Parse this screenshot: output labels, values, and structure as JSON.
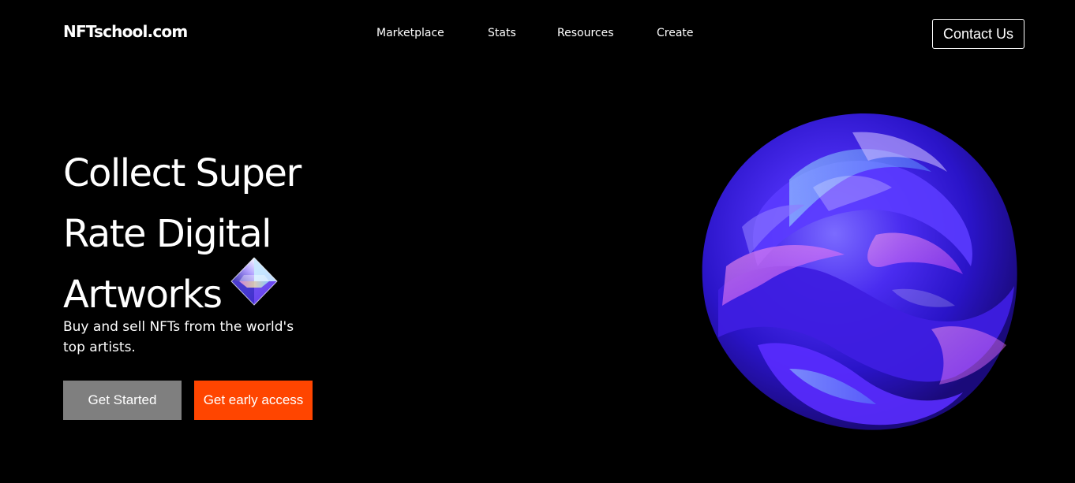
{
  "brand": {
    "logo_text": "NFTschool.com"
  },
  "nav": {
    "items": [
      {
        "label": "Marketplace"
      },
      {
        "label": "Stats"
      },
      {
        "label": "Resources"
      },
      {
        "label": "Create"
      }
    ],
    "contact_label": "Contact Us"
  },
  "hero": {
    "headline_lines": [
      "Collect Super",
      "Rate Digital",
      "Artworks"
    ],
    "subtext": "Buy and sell NFTs from the world's top artists.",
    "primary_button": "Get Started",
    "secondary_button": "Get early access",
    "decor_icon": "diamond-gem-icon",
    "art_image": "holographic-sphere-icon"
  },
  "colors": {
    "background": "#000000",
    "text": "#ffffff",
    "primary_button_bg": "#7f7f7f",
    "accent_button_bg": "#ff4500"
  }
}
